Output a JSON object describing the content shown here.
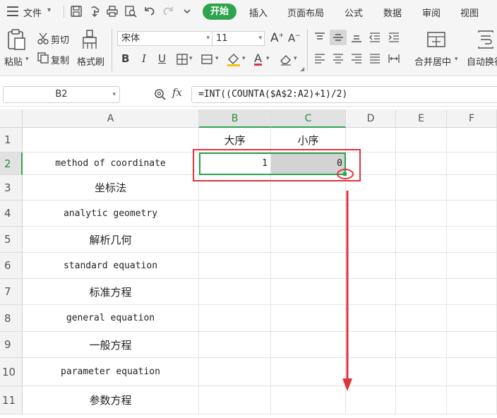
{
  "menu": {
    "file_label": "文件",
    "tabs": [
      "开始",
      "插入",
      "页面布局",
      "公式",
      "数据",
      "审阅",
      "视图"
    ],
    "active_tab": "开始"
  },
  "ribbon": {
    "paste": "粘贴",
    "cut": "剪切",
    "copy": "复制",
    "format_painter": "格式刷",
    "font_name": "宋体",
    "font_size": "11",
    "bold": "B",
    "italic": "I",
    "underline": "U",
    "font_color_glyph": "A",
    "grow_font": "A",
    "shrink_font": "A",
    "merge_center": "合并居中",
    "wrap_text": "自动换行"
  },
  "formula_bar": {
    "cell_ref": "B2",
    "fx_label": "fx",
    "formula": "=INT((COUNTA($A$2:A2)+1)/2)"
  },
  "sheet": {
    "columns": [
      "A",
      "B",
      "C",
      "D",
      "E",
      "F"
    ],
    "active_columns": [
      "B",
      "C"
    ],
    "rows": [
      {
        "num": "1",
        "A": "",
        "B": "大序",
        "C": "小序"
      },
      {
        "num": "2",
        "A": "method of coordinate",
        "B": "1",
        "C": "0"
      },
      {
        "num": "3",
        "A": "坐标法",
        "B": "",
        "C": ""
      },
      {
        "num": "4",
        "A": "analytic geometry",
        "B": "",
        "C": ""
      },
      {
        "num": "5",
        "A": "解析几何",
        "B": "",
        "C": ""
      },
      {
        "num": "6",
        "A": "standard equation",
        "B": "",
        "C": ""
      },
      {
        "num": "7",
        "A": "标准方程",
        "B": "",
        "C": ""
      },
      {
        "num": "8",
        "A": "general equation",
        "B": "",
        "C": ""
      },
      {
        "num": "9",
        "A": "一般方程",
        "B": "",
        "C": ""
      },
      {
        "num": "10",
        "A": "parameter  equation",
        "B": "",
        "C": ""
      },
      {
        "num": "11",
        "A": "参数方程",
        "B": "",
        "C": ""
      }
    ]
  },
  "colors": {
    "accent_green": "#2ea44f",
    "annotation_red": "#e0343d"
  }
}
